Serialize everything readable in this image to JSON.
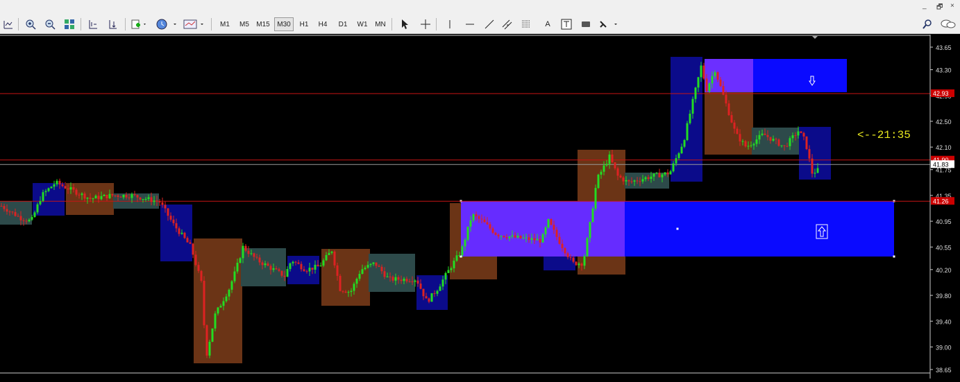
{
  "toolbar": {
    "timeframes": [
      "M1",
      "M5",
      "M15",
      "M30",
      "H1",
      "H4",
      "D1",
      "W1",
      "MN"
    ],
    "active_timeframe": "M30",
    "text_tool": "A",
    "window_controls": [
      "_",
      "🗗",
      "×"
    ]
  },
  "chart_data": {
    "type": "candlestick",
    "y_ticks": [
      "43.65",
      "43.30",
      "42.90",
      "42.50",
      "42.10",
      "41.75",
      "41.35",
      "40.95",
      "40.55",
      "40.20",
      "39.80",
      "39.40",
      "39.00",
      "38.65"
    ],
    "ylim": [
      38.5,
      43.8
    ],
    "price_labels": [
      {
        "value": "42.93",
        "color": "#cc0000"
      },
      {
        "value": "41.90",
        "color": "#cc0000"
      },
      {
        "value": "41.83",
        "color": "#ffffff"
      },
      {
        "value": "41.26",
        "color": "#cc0000"
      }
    ],
    "horizontal_lines": [
      {
        "price": 42.93,
        "color": "#c81414"
      },
      {
        "price": 41.9,
        "color": "#c81414"
      },
      {
        "price": 41.83,
        "color": "#9a9a9a"
      },
      {
        "price": 41.26,
        "color": "#c81414"
      }
    ],
    "annotation": "<--21:35",
    "up_color": "#22dd22",
    "down_color": "#dd2222"
  }
}
